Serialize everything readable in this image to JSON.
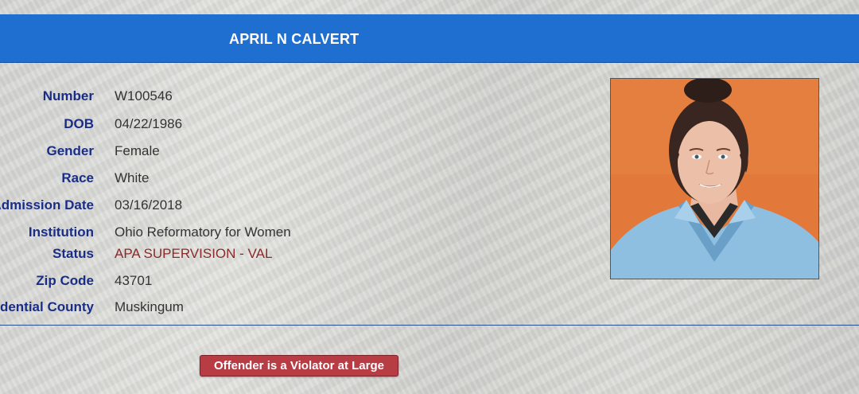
{
  "header": {
    "title": "APRIL N CALVERT"
  },
  "offender_details": [
    {
      "label": "Number",
      "value": "W100546"
    },
    {
      "label": "DOB",
      "value": "04/22/1986"
    },
    {
      "label": "Gender",
      "value": "Female"
    },
    {
      "label": "Race",
      "value": "White"
    },
    {
      "label": "Admission Date",
      "value": "03/16/2018"
    },
    {
      "label": "Institution",
      "value": "Ohio Reformatory for Women"
    },
    {
      "label": "Status",
      "value": "APA SUPERVISION - VAL"
    },
    {
      "label": "Zip Code",
      "value": "43701"
    },
    {
      "label": "Residential County",
      "value": "Muskingum"
    }
  ],
  "photo": {
    "icon": "offender-photo"
  },
  "status_badge": {
    "label": "Offender is a Violator at Large"
  },
  "colors": {
    "header_bar": "#1f6fd1",
    "label_text": "#1a2d86",
    "status_value_text": "#8a2a2a",
    "badge_background": "#b73c44"
  }
}
